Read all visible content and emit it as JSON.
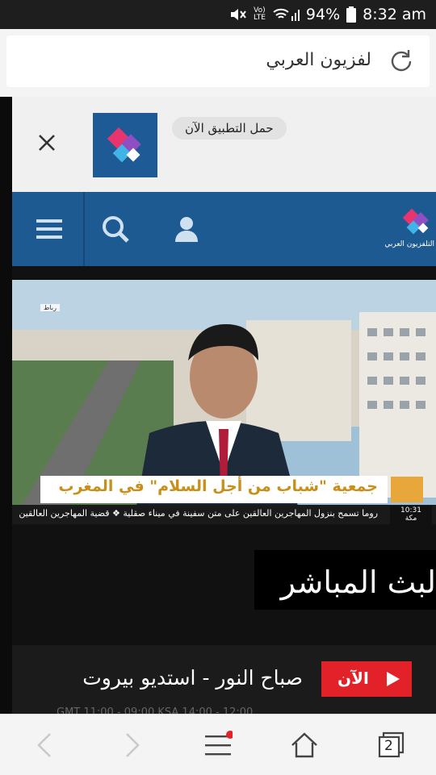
{
  "status_bar": {
    "volte_top": "Vo)",
    "volte_bottom": "LTE",
    "battery": "94%",
    "time": "8:32 am"
  },
  "address_bar": {
    "url_text": "لفزيون العربي"
  },
  "app_banner": {
    "download_text": "حمل التطبيق الآن"
  },
  "site_logo_caption": "التلفزيون العربي",
  "video": {
    "location_tag": "رباط",
    "lower_third": "جمعية \"شباب من أجل السلام\" في المغرب",
    "ticker": "روما تسمح بنزول المهاجرين العالقين على متن سفينة في ميناء صقلية  ❖  قضية المهاجرين العالقين",
    "time": "10:31",
    "city": "مكة"
  },
  "live_heading": "لبث المباشر",
  "program": {
    "now_label": "الآن",
    "title": "صباح النور - استديو بيروت",
    "subtitle": "GMT 11:00 - 09:00 KSA 14:00 - 12:00"
  },
  "bottom_bar": {
    "tabs_count": "2"
  },
  "colors": {
    "brand_blue": "#1d5a92",
    "live_red": "#e32128",
    "notification_dot": "#e32128"
  }
}
